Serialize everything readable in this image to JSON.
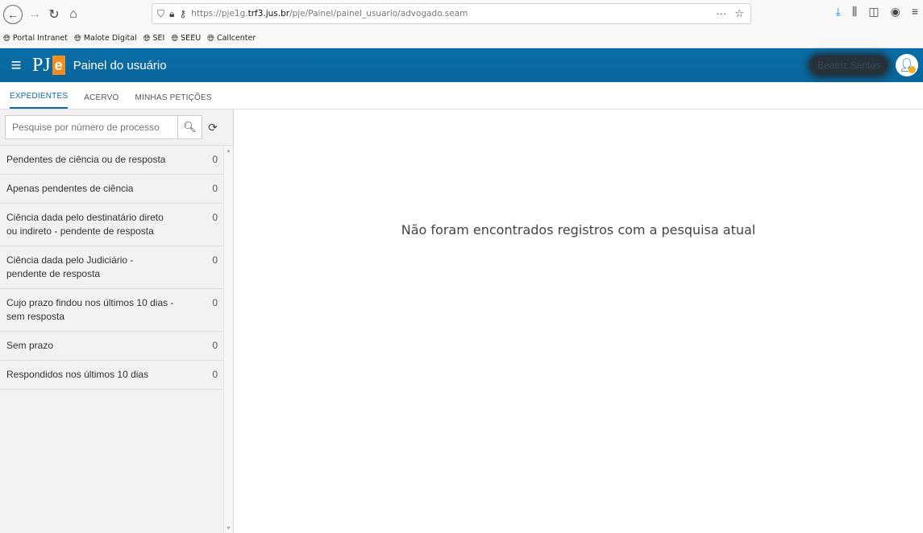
{
  "browser": {
    "url_prefix": "https://pje1g.",
    "url_domain": "trf3.jus.br",
    "url_path": "/pje/Painel/painel_usuario/advogado.seam",
    "bookmarks": [
      {
        "label": "Portal Intranet"
      },
      {
        "label": "Malote Digital"
      },
      {
        "label": "SEI"
      },
      {
        "label": "SEEU"
      },
      {
        "label": "Callcenter"
      }
    ]
  },
  "header": {
    "logo_pj": "PJ",
    "logo_e": "e",
    "title": "Painel do usuário",
    "user_name": "Beatriz Santos"
  },
  "tabs": [
    {
      "label": "EXPEDIENTES",
      "active": true
    },
    {
      "label": "ACERVO",
      "active": false
    },
    {
      "label": "MINHAS PETIÇÕES",
      "active": false
    }
  ],
  "search": {
    "placeholder": "Pesquise por número de processo"
  },
  "sidebar": {
    "items": [
      {
        "label": "Pendentes de ciência ou de resposta",
        "count": "0"
      },
      {
        "label": "Apenas pendentes de ciência",
        "count": "0"
      },
      {
        "label": "Ciência dada pelo destinatário direto ou indireto - pendente de resposta",
        "count": "0"
      },
      {
        "label": "Ciência dada pelo Judiciário - pendente de resposta",
        "count": "0"
      },
      {
        "label": "Cujo prazo findou nos últimos 10 dias - sem resposta",
        "count": "0"
      },
      {
        "label": "Sem prazo",
        "count": "0"
      },
      {
        "label": "Respondidos nos últimos 10 dias",
        "count": "0"
      }
    ]
  },
  "main": {
    "empty_message": "Não foram encontrados registros com a pesquisa atual"
  }
}
